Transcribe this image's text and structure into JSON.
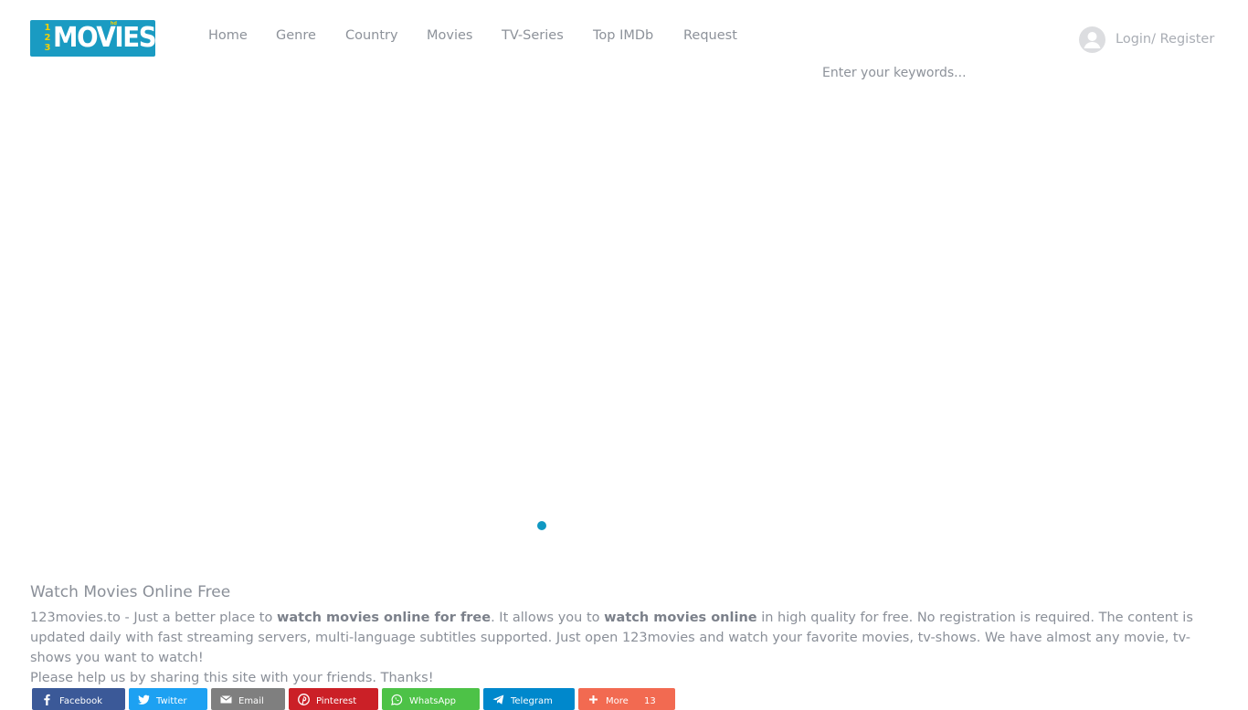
{
  "logo": {
    "digits": [
      "1",
      "2",
      "3"
    ],
    "word": "MOVIES",
    "hd": "hd",
    "colors": {
      "bg": "#1a9bc2",
      "digits": "#f6d000",
      "word": "#ffffff"
    }
  },
  "nav": {
    "items": [
      {
        "label": "Home"
      },
      {
        "label": "Genre"
      },
      {
        "label": "Country"
      },
      {
        "label": "Movies"
      },
      {
        "label": "TV-Series"
      },
      {
        "label": "Top IMDb"
      },
      {
        "label": "Request"
      }
    ]
  },
  "search": {
    "placeholder": "Enter your keywords..."
  },
  "login": {
    "icon": "user-avatar-icon",
    "label": "Login/ Register"
  },
  "loading": {
    "indicator_color": "#1098c2"
  },
  "about": {
    "title": "Watch Movies Online Free",
    "p1": [
      {
        "text": "123movies.to - Just a better place to ",
        "bold": false
      },
      {
        "text": "watch movies online for free",
        "bold": true
      },
      {
        "text": ". It allows you to ",
        "bold": false
      },
      {
        "text": "watch movies online",
        "bold": true
      },
      {
        "text": " in high quality for free. No registration is required. The content is updated daily with fast streaming servers, multi-language subtitles supported. Just open 123movies and watch your favorite movies, tv-shows. We have almost any movie, tv-shows you want to watch!",
        "bold": false
      }
    ],
    "p2": "Please help us by sharing this site with your friends. Thanks!"
  },
  "share": {
    "buttons": [
      {
        "label": "Facebook",
        "icon": "facebook-icon",
        "color": "#3b5998"
      },
      {
        "label": "Twitter",
        "icon": "twitter-icon",
        "color": "#1da1f2"
      },
      {
        "label": "Email",
        "icon": "email-icon",
        "color": "#7f7f7f"
      },
      {
        "label": "Pinterest",
        "icon": "pinterest-icon",
        "color": "#cb2027"
      },
      {
        "label": "WhatsApp",
        "icon": "whatsapp-icon",
        "color": "#4dc247"
      },
      {
        "label": "Telegram",
        "icon": "telegram-icon",
        "color": "#0088cc"
      },
      {
        "label": "More",
        "icon": "plus-icon",
        "color": "#f26a51",
        "count": "13"
      }
    ]
  }
}
